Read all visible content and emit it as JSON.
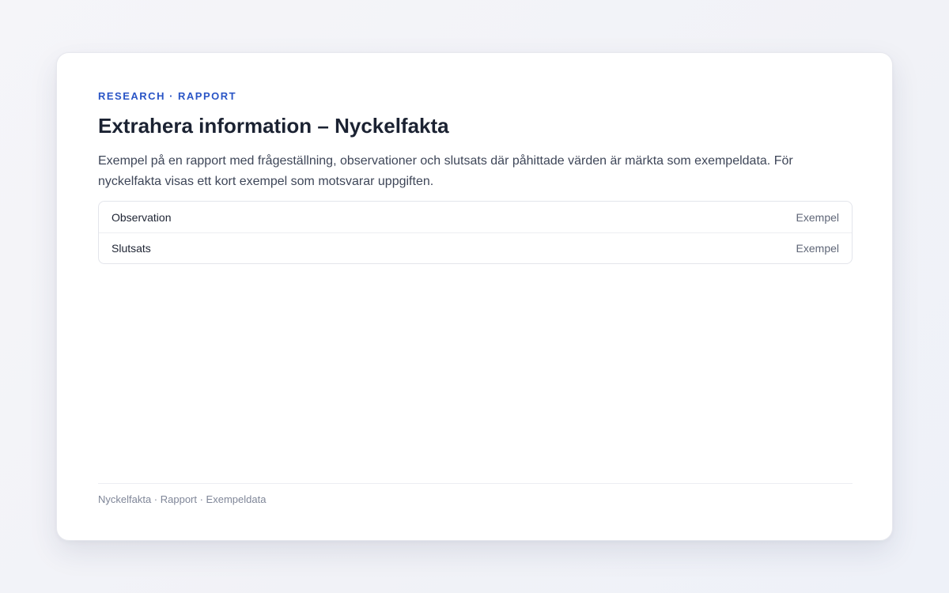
{
  "header": {
    "eyebrow": "RESEARCH · RAPPORT",
    "title": "Extrahera information – Nyckelfakta",
    "description": "Exempel på en rapport med frågeställning, observationer och slutsats där påhittade värden är märkta som exempeldata. För nyckelfakta visas ett kort exempel som motsvarar uppgiften."
  },
  "facts": [
    {
      "label": "Observation",
      "value": "Exempel"
    },
    {
      "label": "Slutsats",
      "value": "Exempel"
    }
  ],
  "footer": {
    "text": "Nyckelfakta · Rapport · Exempeldata"
  },
  "colors": {
    "accent": "#2a55c6",
    "title": "#1b2232",
    "muted": "#7f8698"
  }
}
